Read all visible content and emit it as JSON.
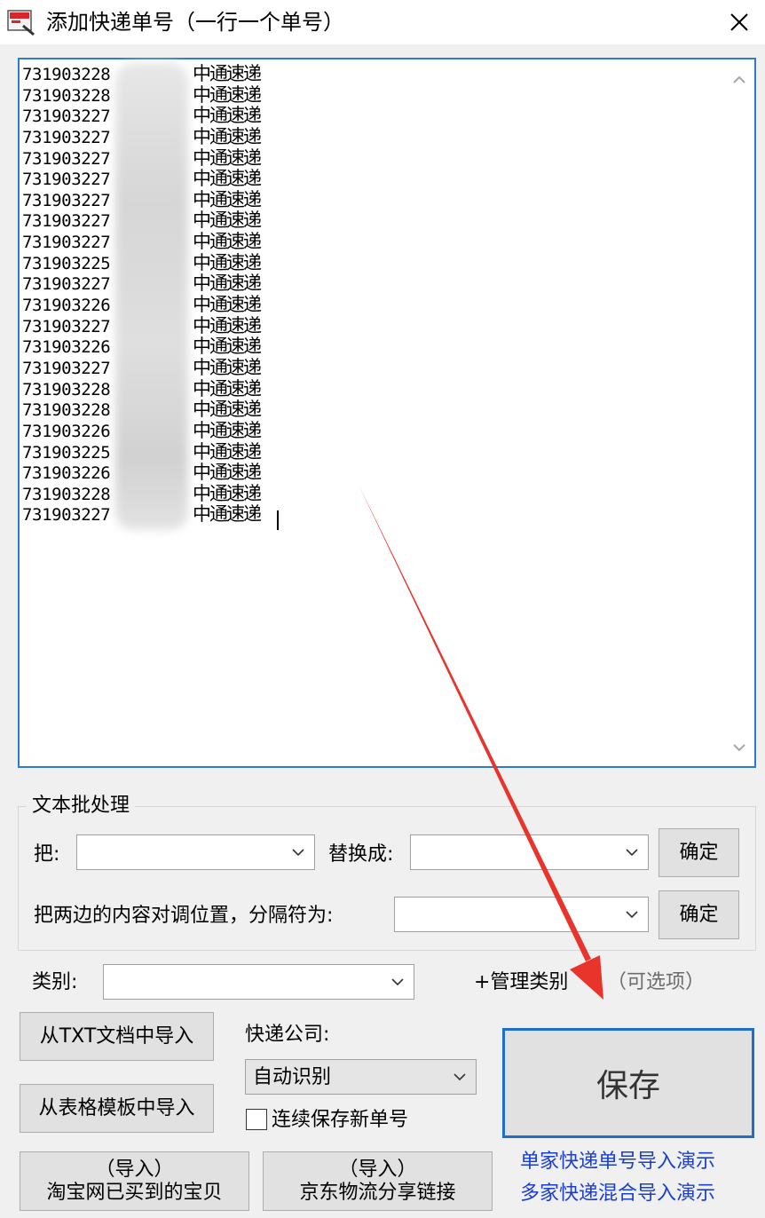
{
  "window": {
    "title": "添加快递单号（一行一个单号）",
    "icon": "app-icon",
    "close_icon": "close-icon"
  },
  "textarea": {
    "lines": [
      {
        "number": "731903228",
        "courier": "中通速递"
      },
      {
        "number": "731903228",
        "courier": "中通速递"
      },
      {
        "number": "731903227",
        "courier": "中通速递"
      },
      {
        "number": "731903227",
        "courier": "中通速递"
      },
      {
        "number": "731903227",
        "courier": "中通速递"
      },
      {
        "number": "731903227",
        "courier": "中通速递"
      },
      {
        "number": "731903227",
        "courier": "中通速递"
      },
      {
        "number": "731903227",
        "courier": "中通速递"
      },
      {
        "number": "731903227",
        "courier": "中通速递"
      },
      {
        "number": "731903225",
        "courier": "中通速递"
      },
      {
        "number": "731903227",
        "courier": "中通速递"
      },
      {
        "number": "731903226",
        "courier": "中通速递"
      },
      {
        "number": "731903227",
        "courier": "中通速递"
      },
      {
        "number": "731903226",
        "courier": "中通速递"
      },
      {
        "number": "731903227",
        "courier": "中通速递"
      },
      {
        "number": "731903228",
        "courier": "中通速递"
      },
      {
        "number": "731903228",
        "courier": "中通速递"
      },
      {
        "number": "731903226",
        "courier": "中通速递"
      },
      {
        "number": "731903225",
        "courier": "中通速递"
      },
      {
        "number": "731903226",
        "courier": "中通速递"
      },
      {
        "number": "731903228",
        "courier": "中通速递"
      },
      {
        "number": "731903227",
        "courier": "中通速递"
      }
    ]
  },
  "batch": {
    "group_title": "文本批处理",
    "replace_from_label": "把:",
    "replace_from_value": "",
    "replace_to_label": "替换成:",
    "replace_to_value": "",
    "confirm1": "确定",
    "swap_label": "把两边的内容对调位置，分隔符为:",
    "swap_value": "",
    "confirm2": "确定"
  },
  "category": {
    "label": "类别:",
    "value": "",
    "manage": "+管理类别",
    "optional": "（可选项）"
  },
  "import": {
    "txt": "从TXT文档中导入",
    "table": "从表格模板中导入",
    "taobao_line1": "（导入）",
    "taobao_line2": "淘宝网已买到的宝贝",
    "jd_line1": "（导入）",
    "jd_line2": "京东物流分享链接"
  },
  "courier": {
    "label": "快递公司:",
    "value": "自动识别",
    "continuous_label": "连续保存新单号",
    "continuous_checked": false
  },
  "save": {
    "label": "保存"
  },
  "links": {
    "single": "单家快递单号导入演示",
    "multi": "多家快递混合导入演示"
  },
  "colors": {
    "accent": "#1f6fc9",
    "link": "#1b3fcc",
    "annotation_arrow": "#e8342a"
  }
}
